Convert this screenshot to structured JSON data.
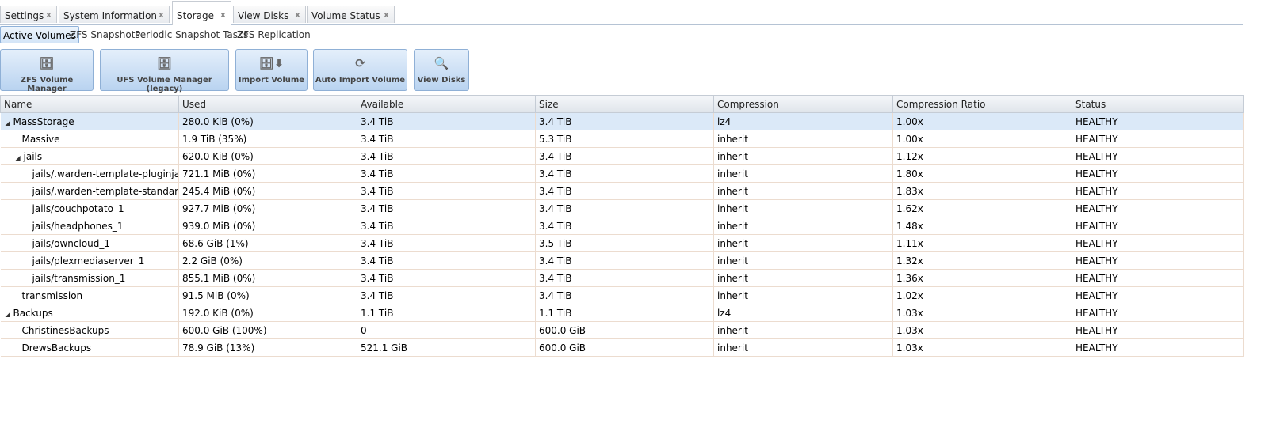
{
  "tabs": [
    {
      "label": "Settings"
    },
    {
      "label": "System Information"
    },
    {
      "label": "Storage"
    },
    {
      "label": "View Disks"
    },
    {
      "label": "Volume Status"
    }
  ],
  "close_glyph": "x",
  "subtabs": [
    {
      "label": "Active Volumes"
    },
    {
      "label": "ZFS Snapshots"
    },
    {
      "label": "Periodic Snapshot Tasks"
    },
    {
      "label": "ZFS Replication"
    }
  ],
  "buttons": [
    {
      "label": "ZFS Volume Manager",
      "icon": "disk-add-icon"
    },
    {
      "label": "UFS Volume Manager (legacy)",
      "icon": "disk-add-icon"
    },
    {
      "label": "Import Volume",
      "icon": "disk-import-icon"
    },
    {
      "label": "Auto Import Volume",
      "icon": "disk-refresh-icon"
    },
    {
      "label": "View Disks",
      "icon": "disk-search-icon"
    }
  ],
  "columns": [
    "Name",
    "Used",
    "Available",
    "Size",
    "Compression",
    "Compression Ratio",
    "Status"
  ],
  "rows": [
    [
      "MassStorage",
      "280.0 KiB (0%)",
      "3.4 TiB",
      "3.4 TiB",
      "lz4",
      "1.00x",
      "HEALTHY"
    ],
    [
      "Massive",
      "1.9 TiB (35%)",
      "3.4 TiB",
      "5.3 TiB",
      "inherit",
      "1.00x",
      "HEALTHY"
    ],
    [
      "jails",
      "620.0 KiB (0%)",
      "3.4 TiB",
      "3.4 TiB",
      "inherit",
      "1.12x",
      "HEALTHY"
    ],
    [
      "jails/.warden-template-pluginjail",
      "721.1 MiB (0%)",
      "3.4 TiB",
      "3.4 TiB",
      "inherit",
      "1.80x",
      "HEALTHY"
    ],
    [
      "jails/.warden-template-standard",
      "245.4 MiB (0%)",
      "3.4 TiB",
      "3.4 TiB",
      "inherit",
      "1.83x",
      "HEALTHY"
    ],
    [
      "jails/couchpotato_1",
      "927.7 MiB (0%)",
      "3.4 TiB",
      "3.4 TiB",
      "inherit",
      "1.62x",
      "HEALTHY"
    ],
    [
      "jails/headphones_1",
      "939.0 MiB (0%)",
      "3.4 TiB",
      "3.4 TiB",
      "inherit",
      "1.48x",
      "HEALTHY"
    ],
    [
      "jails/owncloud_1",
      "68.6 GiB (1%)",
      "3.4 TiB",
      "3.5 TiB",
      "inherit",
      "1.11x",
      "HEALTHY"
    ],
    [
      "jails/plexmediaserver_1",
      "2.2 GiB (0%)",
      "3.4 TiB",
      "3.4 TiB",
      "inherit",
      "1.32x",
      "HEALTHY"
    ],
    [
      "jails/transmission_1",
      "855.1 MiB (0%)",
      "3.4 TiB",
      "3.4 TiB",
      "inherit",
      "1.36x",
      "HEALTHY"
    ],
    [
      "transmission",
      "91.5 MiB (0%)",
      "3.4 TiB",
      "3.4 TiB",
      "inherit",
      "1.02x",
      "HEALTHY"
    ],
    [
      "Backups",
      "192.0 KiB (0%)",
      "1.1 TiB",
      "1.1 TiB",
      "lz4",
      "1.03x",
      "HEALTHY"
    ],
    [
      "ChristinesBackups",
      "600.0 GiB (100%)",
      "0",
      "600.0 GiB",
      "inherit",
      "1.03x",
      "HEALTHY"
    ],
    [
      "DrewsBackups",
      "78.9 GiB (13%)",
      "521.1 GiB",
      "600.0 GiB",
      "inherit",
      "1.03x",
      "HEALTHY"
    ]
  ]
}
